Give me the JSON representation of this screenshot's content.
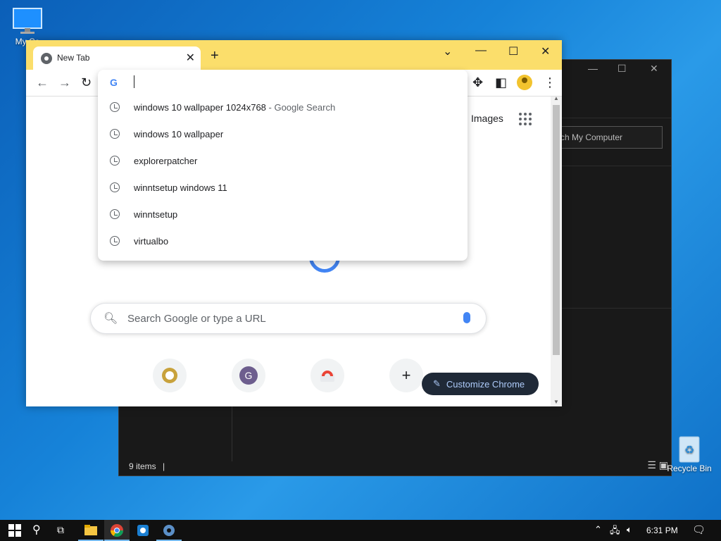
{
  "desktop": {
    "my_computer_label": "My Co",
    "recycle_label": "Recycle Bin"
  },
  "explorer": {
    "search_placeholder": "rch My Computer",
    "status_items": "9 items"
  },
  "chrome": {
    "tab_title": "New Tab",
    "images_link": "Images",
    "search_placeholder": "Search Google or type a URL",
    "customize_label": "Customize Chrome",
    "omnibox_suggestions": [
      {
        "text": "windows 10 wallpaper 1024x768",
        "hint": " - Google Search"
      },
      {
        "text": "windows 10 wallpaper",
        "hint": ""
      },
      {
        "text": "explorerpatcher",
        "hint": ""
      },
      {
        "text": "winntsetup windows 11",
        "hint": ""
      },
      {
        "text": "winntsetup",
        "hint": ""
      },
      {
        "text": "virtualbo",
        "hint": ""
      }
    ],
    "shortcut_letter": "G"
  },
  "taskbar": {
    "time": "6:31 PM"
  },
  "colors": {
    "chrome_frame": "#fbde6b",
    "accent_blue": "#4285f4",
    "customize_bg": "#1f2937"
  }
}
